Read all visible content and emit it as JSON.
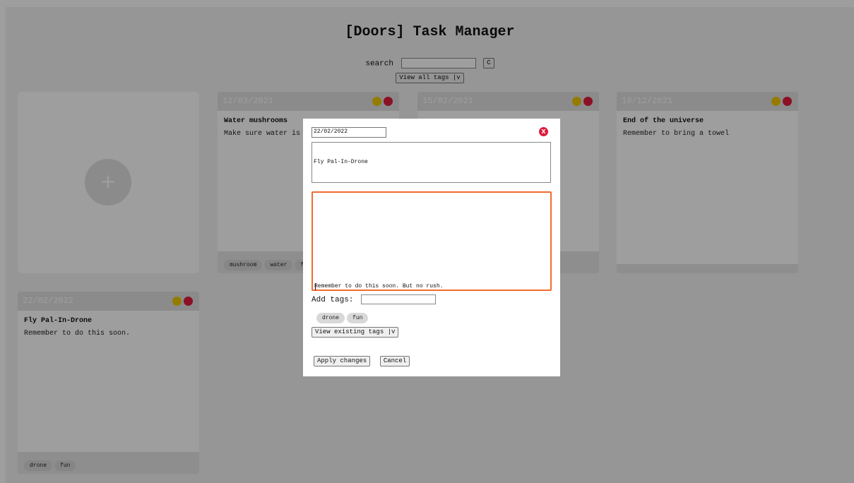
{
  "app": {
    "title": "[Doors] Task Manager",
    "search_label": "search",
    "search_value": "",
    "clear_button": "C",
    "view_all_tags": "View all tags |v"
  },
  "cards": [
    {
      "date": "12/03/2021",
      "title": "Water mushrooms",
      "description": "Make sure water is",
      "tags": [
        "mushroom",
        "water",
        "f"
      ]
    },
    {
      "date": "15/02/2021",
      "title": "",
      "description": "",
      "tags": []
    },
    {
      "date": "19/12/2021",
      "title": "End of the universe",
      "description": "Remember to bring a towel",
      "tags": []
    },
    {
      "date": "22/02/2022",
      "title": "Fly Pal-In-Drone",
      "description": "Remember to do this soon.",
      "tags": [
        "drone",
        "fun"
      ]
    }
  ],
  "add_card": {
    "icon": "plus-icon",
    "symbol": "+"
  },
  "modal": {
    "date_value": "22/02/2022",
    "close_symbol": "X",
    "title_value": "Fly Pal-In-Drone",
    "description_value": "Remember to do this soon. But no rush.",
    "add_tags_label": "Add tags:",
    "add_tags_value": "",
    "tags": [
      "drone",
      "fun"
    ],
    "view_existing_tags": "View existing tags |v",
    "apply_button": "Apply changes",
    "cancel_button": "Cancel"
  },
  "colors": {
    "priority_yellow": "#f0c800",
    "priority_red": "#e01a3c",
    "focus_border": "#f26a2e"
  }
}
